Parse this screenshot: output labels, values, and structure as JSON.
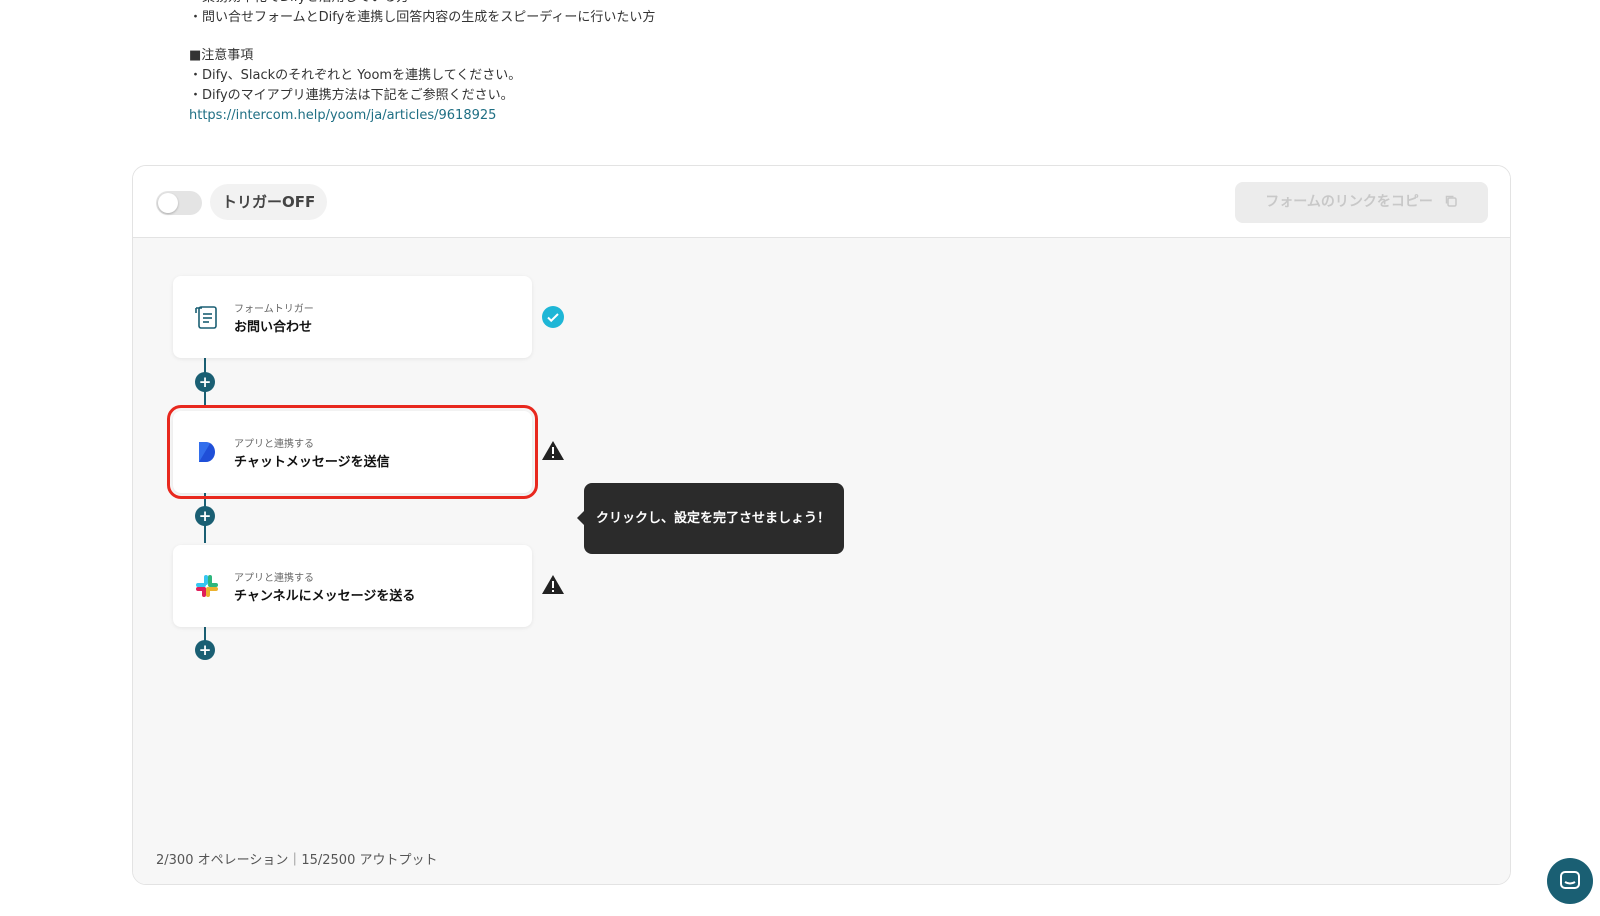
{
  "description": {
    "lines": [
      "・業務効率化でDifyを活用している方",
      "・問い合せフォームとDifyを連携し回答内容の生成をスピーディーに行いたい方",
      "",
      "■注意事項",
      "・Dify、Slackのそれぞれと Yoomを連携してください。",
      "・Difyのマイアプリ連携方法は下記をご参照ください。"
    ],
    "link": "https://intercom.help/yoom/ja/articles/9618925"
  },
  "header": {
    "trigger_toggle_label": "トリガーOFF",
    "copy_button_label": "フォームのリンクをコピー"
  },
  "steps": [
    {
      "subtitle": "フォームトリガー",
      "title": "お問い合わせ",
      "icon": "form-icon",
      "status": "done"
    },
    {
      "subtitle": "アプリと連携する",
      "title": "チャットメッセージを送信",
      "icon": "dify-icon",
      "status": "warning"
    },
    {
      "subtitle": "アプリと連携する",
      "title": "チャンネルにメッセージを送る",
      "icon": "slack-icon",
      "status": "warning"
    }
  ],
  "tooltip": "クリックし、設定を完了させましょう！",
  "usage": "2/300 オペレーション｜15/2500 アウトプット",
  "colors": {
    "accent": "#1a5f73",
    "highlight": "#e8281e",
    "check": "#1eb6d6"
  }
}
